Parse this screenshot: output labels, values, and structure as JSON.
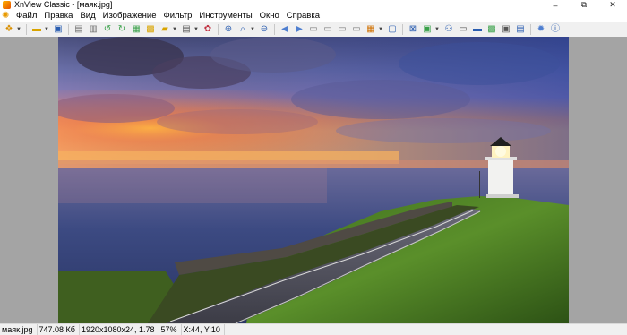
{
  "window": {
    "title": "XnView Classic - [маяк.jpg]",
    "controls": [
      "–",
      "⧉",
      "✕"
    ]
  },
  "menu": {
    "items": [
      "Файл",
      "Правка",
      "Вид",
      "Изображение",
      "Фильтр",
      "Инструменты",
      "Окно",
      "Справка"
    ]
  },
  "toolbar": {
    "icons": [
      "browser-icon",
      "open-folder-icon",
      "save-icon",
      "print-preview-icon",
      "acquire-icon",
      "rotate-left-icon",
      "rotate-right-icon",
      "image-icon",
      "gallery-icon",
      "slideshow-icon",
      "layout-icon",
      "effects-icon",
      "zoom-in-icon",
      "zoom-icon",
      "zoom-out-icon",
      "previous-icon",
      "next-icon",
      "first-icon",
      "last-icon",
      "frame-icon",
      "frame-next-icon",
      "thumbnails-icon",
      "fullscreen-icon",
      "copy-icon",
      "find-icon",
      "printer-icon",
      "scanner-icon",
      "photo-icon",
      "capture-icon",
      "monitor-icon",
      "settings-icon",
      "info-icon"
    ]
  },
  "status": {
    "filename": "маяк.jpg",
    "filesize": "747.08 Кб",
    "dimensions": "1920x1080x24, 1.78",
    "zoom": "57%",
    "coords": "X:44, Y:10"
  },
  "colors": {
    "viewer_bg": "#a4a4a4",
    "chrome_bg": "#f0f0f0"
  }
}
